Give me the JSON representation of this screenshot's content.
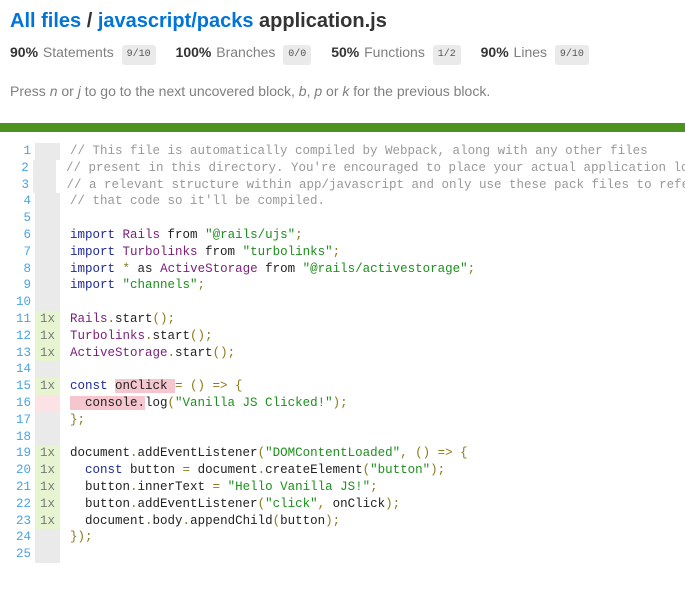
{
  "breadcrumb": {
    "root_link": "All files",
    "separator": "/",
    "dir_link": "javascript/packs",
    "file": "application.js"
  },
  "summary": [
    {
      "pct": "90%",
      "label": "Statements",
      "fraction": "9/10"
    },
    {
      "pct": "100%",
      "label": "Branches",
      "fraction": "0/0"
    },
    {
      "pct": "50%",
      "label": "Functions",
      "fraction": "1/2"
    },
    {
      "pct": "90%",
      "label": "Lines",
      "fraction": "9/10"
    }
  ],
  "hint": {
    "t1": "Press ",
    "k1": "n",
    "t2": " or ",
    "k2": "j",
    "t3": " to go to the next uncovered block, ",
    "k3": "b",
    "t4": ", ",
    "k4": "p",
    "t5": " or ",
    "k5": "k",
    "t6": " for the previous block."
  },
  "status_color": "#4d9221",
  "lines": [
    {
      "n": "1",
      "count": "",
      "cov": "neutral",
      "tokens": [
        [
          "cm",
          "// This file is automatically compiled by Webpack, along with any other files"
        ]
      ]
    },
    {
      "n": "2",
      "count": "",
      "cov": "neutral",
      "tokens": [
        [
          "cm",
          "// present in this directory. You're encouraged to place your actual application logic in"
        ]
      ]
    },
    {
      "n": "3",
      "count": "",
      "cov": "neutral",
      "tokens": [
        [
          "cm",
          "// a relevant structure within app/javascript and only use these pack files to reference"
        ]
      ]
    },
    {
      "n": "4",
      "count": "",
      "cov": "neutral",
      "tokens": [
        [
          "cm",
          "// that code so it'll be compiled."
        ]
      ]
    },
    {
      "n": "5",
      "count": "",
      "cov": "neutral",
      "tokens": []
    },
    {
      "n": "6",
      "count": "",
      "cov": "neutral",
      "tokens": [
        [
          "kw",
          "import"
        ],
        [
          "",
          " "
        ],
        [
          "id",
          "Rails"
        ],
        [
          "",
          " from "
        ],
        [
          "str",
          "\"@rails/ujs\""
        ],
        [
          "pn",
          ";"
        ]
      ]
    },
    {
      "n": "7",
      "count": "",
      "cov": "neutral",
      "tokens": [
        [
          "kw",
          "import"
        ],
        [
          "",
          " "
        ],
        [
          "id",
          "Turbolinks"
        ],
        [
          "",
          " from "
        ],
        [
          "str",
          "\"turbolinks\""
        ],
        [
          "pn",
          ";"
        ]
      ]
    },
    {
      "n": "8",
      "count": "",
      "cov": "neutral",
      "tokens": [
        [
          "kw",
          "import"
        ],
        [
          "",
          " "
        ],
        [
          "pn",
          "*"
        ],
        [
          "",
          " as "
        ],
        [
          "id",
          "ActiveStorage"
        ],
        [
          "",
          " from "
        ],
        [
          "str",
          "\"@rails/activestorage\""
        ],
        [
          "pn",
          ";"
        ]
      ]
    },
    {
      "n": "9",
      "count": "",
      "cov": "neutral",
      "tokens": [
        [
          "kw",
          "import"
        ],
        [
          "",
          " "
        ],
        [
          "str",
          "\"channels\""
        ],
        [
          "pn",
          ";"
        ]
      ]
    },
    {
      "n": "10",
      "count": "",
      "cov": "neutral",
      "tokens": []
    },
    {
      "n": "11",
      "count": "1x",
      "cov": "hit",
      "tokens": [
        [
          "id",
          "Rails"
        ],
        [
          "pn",
          "."
        ],
        [
          "",
          "start"
        ],
        [
          "pn",
          "();"
        ]
      ]
    },
    {
      "n": "12",
      "count": "1x",
      "cov": "hit",
      "tokens": [
        [
          "id",
          "Turbolinks"
        ],
        [
          "pn",
          "."
        ],
        [
          "",
          "start"
        ],
        [
          "pn",
          "();"
        ]
      ]
    },
    {
      "n": "13",
      "count": "1x",
      "cov": "hit",
      "tokens": [
        [
          "id",
          "ActiveStorage"
        ],
        [
          "pn",
          "."
        ],
        [
          "",
          "start"
        ],
        [
          "pn",
          "();"
        ]
      ]
    },
    {
      "n": "14",
      "count": "",
      "cov": "neutral",
      "tokens": []
    },
    {
      "n": "15",
      "count": "1x",
      "cov": "hit",
      "tokens": [
        [
          "kw",
          "const"
        ],
        [
          "",
          " "
        ],
        [
          "uncov",
          "onClick "
        ],
        [
          "pn",
          "= () => {"
        ]
      ]
    },
    {
      "n": "16",
      "count": "",
      "cov": "miss",
      "tokens": [
        [
          "uncov",
          "  console."
        ],
        [
          "",
          "log"
        ],
        [
          "pn",
          "("
        ],
        [
          "str",
          "\"Vanilla JS Clicked!\""
        ],
        [
          "pn",
          ");"
        ]
      ]
    },
    {
      "n": "17",
      "count": "",
      "cov": "neutral",
      "tokens": [
        [
          "pn",
          "};"
        ]
      ]
    },
    {
      "n": "18",
      "count": "",
      "cov": "neutral",
      "tokens": []
    },
    {
      "n": "19",
      "count": "1x",
      "cov": "hit",
      "tokens": [
        [
          "",
          "document"
        ],
        [
          "pn",
          "."
        ],
        [
          "",
          "addEventListener"
        ],
        [
          "pn",
          "("
        ],
        [
          "str",
          "\"DOMContentLoaded\""
        ],
        [
          "pn",
          ", () => {"
        ]
      ]
    },
    {
      "n": "20",
      "count": "1x",
      "cov": "hit",
      "tokens": [
        [
          "",
          "  "
        ],
        [
          "kw",
          "const"
        ],
        [
          "",
          " button "
        ],
        [
          "pn",
          "="
        ],
        [
          "",
          " document"
        ],
        [
          "pn",
          "."
        ],
        [
          "",
          "createElement"
        ],
        [
          "pn",
          "("
        ],
        [
          "str",
          "\"button\""
        ],
        [
          "pn",
          ");"
        ]
      ]
    },
    {
      "n": "21",
      "count": "1x",
      "cov": "hit",
      "tokens": [
        [
          "",
          "  button"
        ],
        [
          "pn",
          "."
        ],
        [
          "",
          "innerText "
        ],
        [
          "pn",
          "="
        ],
        [
          "",
          " "
        ],
        [
          "str",
          "\"Hello Vanilla JS!\""
        ],
        [
          "pn",
          ";"
        ]
      ]
    },
    {
      "n": "22",
      "count": "1x",
      "cov": "hit",
      "tokens": [
        [
          "",
          "  button"
        ],
        [
          "pn",
          "."
        ],
        [
          "",
          "addEventListener"
        ],
        [
          "pn",
          "("
        ],
        [
          "str",
          "\"click\""
        ],
        [
          "pn",
          ","
        ],
        [
          "",
          " onClick"
        ],
        [
          "pn",
          ");"
        ]
      ]
    },
    {
      "n": "23",
      "count": "1x",
      "cov": "hit",
      "tokens": [
        [
          "",
          "  document"
        ],
        [
          "pn",
          "."
        ],
        [
          "",
          "body"
        ],
        [
          "pn",
          "."
        ],
        [
          "",
          "appendChild"
        ],
        [
          "pn",
          "("
        ],
        [
          "",
          "button"
        ],
        [
          "pn",
          ");"
        ]
      ]
    },
    {
      "n": "24",
      "count": "",
      "cov": "neutral",
      "tokens": [
        [
          "pn",
          "});"
        ]
      ]
    },
    {
      "n": "25",
      "count": "",
      "cov": "neutral",
      "tokens": []
    }
  ]
}
